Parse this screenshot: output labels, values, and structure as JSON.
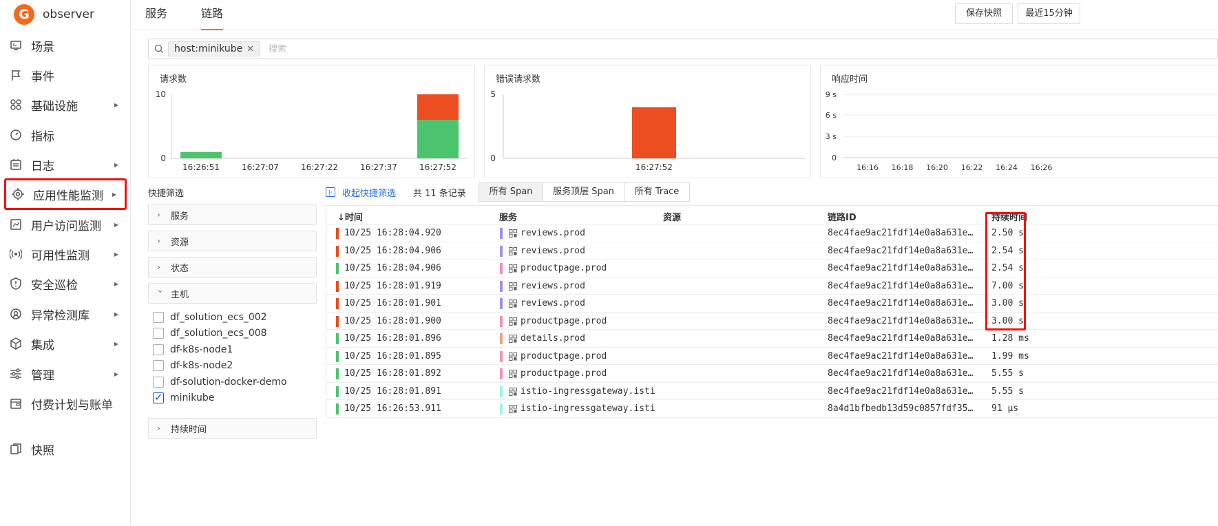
{
  "app": {
    "logo_letter": "G",
    "name": "observer"
  },
  "sidebar": {
    "items": [
      {
        "label": "场景",
        "icon": "monitor-icon",
        "has_arrow": false
      },
      {
        "label": "事件",
        "icon": "flag-icon",
        "has_arrow": false
      },
      {
        "label": "基础设施",
        "icon": "grid-circles-icon",
        "has_arrow": true
      },
      {
        "label": "指标",
        "icon": "gauge-icon",
        "has_arrow": false
      },
      {
        "label": "日志",
        "icon": "calendar-list-icon",
        "has_arrow": true
      },
      {
        "label": "应用性能监测",
        "icon": "target-icon",
        "has_arrow": true,
        "highlighted": true
      },
      {
        "label": "用户访问监测",
        "icon": "chart-window-icon",
        "has_arrow": true
      },
      {
        "label": "可用性监测",
        "icon": "signal-icon",
        "has_arrow": true
      },
      {
        "label": "安全巡检",
        "icon": "shield-icon",
        "has_arrow": true
      },
      {
        "label": "异常检测库",
        "icon": "radar-user-icon",
        "has_arrow": true
      },
      {
        "label": "集成",
        "icon": "cube-icon",
        "has_arrow": true
      },
      {
        "label": "管理",
        "icon": "sliders-icon",
        "has_arrow": true
      },
      {
        "label": "付费计划与账单",
        "icon": "wallet-icon",
        "has_arrow": false
      }
    ],
    "snapshot_label": "快照"
  },
  "topbar": {
    "tabs": [
      {
        "label": "服务",
        "active": false
      },
      {
        "label": "链路",
        "active": true
      }
    ],
    "save_snapshot": "保存快照",
    "time_range": "最近15分钟"
  },
  "search": {
    "tag": "host:minikube",
    "placeholder": "搜索"
  },
  "charts": {
    "requests": {
      "title": "请求数",
      "chart_data": {
        "type": "bar",
        "stacked": true,
        "categories": [
          "16:26:51",
          "16:27:07",
          "16:27:22",
          "16:27:37",
          "16:27:52"
        ],
        "ylim": [
          0,
          10
        ],
        "yticks": [
          "10",
          "0"
        ],
        "series": [
          {
            "color": "#4cc46e",
            "values": [
              1,
              0,
              0,
              0,
              6
            ]
          },
          {
            "color": "#ec4e22",
            "values": [
              0,
              0,
              0,
              0,
              4
            ]
          }
        ]
      }
    },
    "errors": {
      "title": "错误请求数",
      "chart_data": {
        "type": "bar",
        "categories": [
          "16:27:52"
        ],
        "ylim": [
          0,
          5
        ],
        "yticks": [
          "5",
          "0"
        ],
        "series": [
          {
            "color": "#ec4e22",
            "values": [
              4
            ]
          }
        ]
      }
    },
    "latency": {
      "title": "响应时间",
      "chart_data": {
        "type": "line",
        "x": [
          "16:16",
          "16:18",
          "16:20",
          "16:22",
          "16:24",
          "16:26"
        ],
        "yticks": [
          "9 s",
          "6 s",
          "3 s",
          "0"
        ],
        "series": []
      }
    }
  },
  "quick_filter": {
    "title": "快捷筛选",
    "groups": [
      "服务",
      "资源",
      "状态",
      "主机",
      "持续时间"
    ],
    "hosts": [
      {
        "label": "df_solution_ecs_002",
        "checked": false
      },
      {
        "label": "df_solution_ecs_008",
        "checked": false
      },
      {
        "label": "df-k8s-node1",
        "checked": false
      },
      {
        "label": "df-k8s-node2",
        "checked": false
      },
      {
        "label": "df-solution-docker-demo",
        "checked": false
      },
      {
        "label": "minikube",
        "checked": true
      }
    ]
  },
  "table_toolbar": {
    "collapse_label": "收起快捷筛选",
    "count_label": "共 11 条记录",
    "segments": [
      {
        "label": "所有 Span",
        "active": true
      },
      {
        "label": "服务顶层 Span",
        "active": false
      },
      {
        "label": "所有 Trace",
        "active": false
      }
    ]
  },
  "table": {
    "headers": {
      "time": "↓时间",
      "service": "服务",
      "resource": "资源",
      "trace_id": "链路ID",
      "duration": "持续时间"
    },
    "rows": [
      {
        "status_color": "#e84d21",
        "time": "10/25 16:28:04.920",
        "svc_color": "#a48cf0",
        "service": "reviews.prod",
        "resource": "",
        "trace_id": "8ec4fae9ac21fdf14e0a8a631e…",
        "duration": "2.50 s"
      },
      {
        "status_color": "#e84d21",
        "time": "10/25 16:28:04.906",
        "svc_color": "#a48cf0",
        "service": "reviews.prod",
        "resource": "",
        "trace_id": "8ec4fae9ac21fdf14e0a8a631e…",
        "duration": "2.54 s"
      },
      {
        "status_color": "#4cc46e",
        "time": "10/25 16:28:04.906",
        "svc_color": "#f28fbf",
        "service": "productpage.prod",
        "resource": "",
        "trace_id": "8ec4fae9ac21fdf14e0a8a631e…",
        "duration": "2.54 s"
      },
      {
        "status_color": "#e84d21",
        "time": "10/25 16:28:01.919",
        "svc_color": "#a48cf0",
        "service": "reviews.prod",
        "resource": "",
        "trace_id": "8ec4fae9ac21fdf14e0a8a631e…",
        "duration": "7.00 s"
      },
      {
        "status_color": "#e84d21",
        "time": "10/25 16:28:01.901",
        "svc_color": "#a48cf0",
        "service": "reviews.prod",
        "resource": "",
        "trace_id": "8ec4fae9ac21fdf14e0a8a631e…",
        "duration": "3.00 s"
      },
      {
        "status_color": "#e84d21",
        "time": "10/25 16:28:01.900",
        "svc_color": "#f28fbf",
        "service": "productpage.prod",
        "resource": "",
        "trace_id": "8ec4fae9ac21fdf14e0a8a631e…",
        "duration": "3.00 s"
      },
      {
        "status_color": "#4cc46e",
        "time": "10/25 16:28:01.896",
        "svc_color": "#f4a27a",
        "service": "details.prod",
        "resource": "",
        "trace_id": "8ec4fae9ac21fdf14e0a8a631e…",
        "duration": "1.28 ms"
      },
      {
        "status_color": "#4cc46e",
        "time": "10/25 16:28:01.895",
        "svc_color": "#f28fbf",
        "service": "productpage.prod",
        "resource": "",
        "trace_id": "8ec4fae9ac21fdf14e0a8a631e…",
        "duration": "1.99 ms"
      },
      {
        "status_color": "#4cc46e",
        "time": "10/25 16:28:01.892",
        "svc_color": "#f28fbf",
        "service": "productpage.prod",
        "resource": "",
        "trace_id": "8ec4fae9ac21fdf14e0a8a631e…",
        "duration": "5.55 s"
      },
      {
        "status_color": "#4cc46e",
        "time": "10/25 16:28:01.891",
        "svc_color": "#9ef2e8",
        "service": "istio-ingressgateway.isti",
        "resource": "",
        "trace_id": "8ec4fae9ac21fdf14e0a8a631e…",
        "duration": "5.55 s"
      },
      {
        "status_color": "#4cc46e",
        "time": "10/25 16:26:53.911",
        "svc_color": "#9ef2e8",
        "service": "istio-ingressgateway.isti",
        "resource": "",
        "trace_id": "8a4d1bfbedb13d59c0857fdf35…",
        "duration": "91 µs"
      }
    ]
  }
}
